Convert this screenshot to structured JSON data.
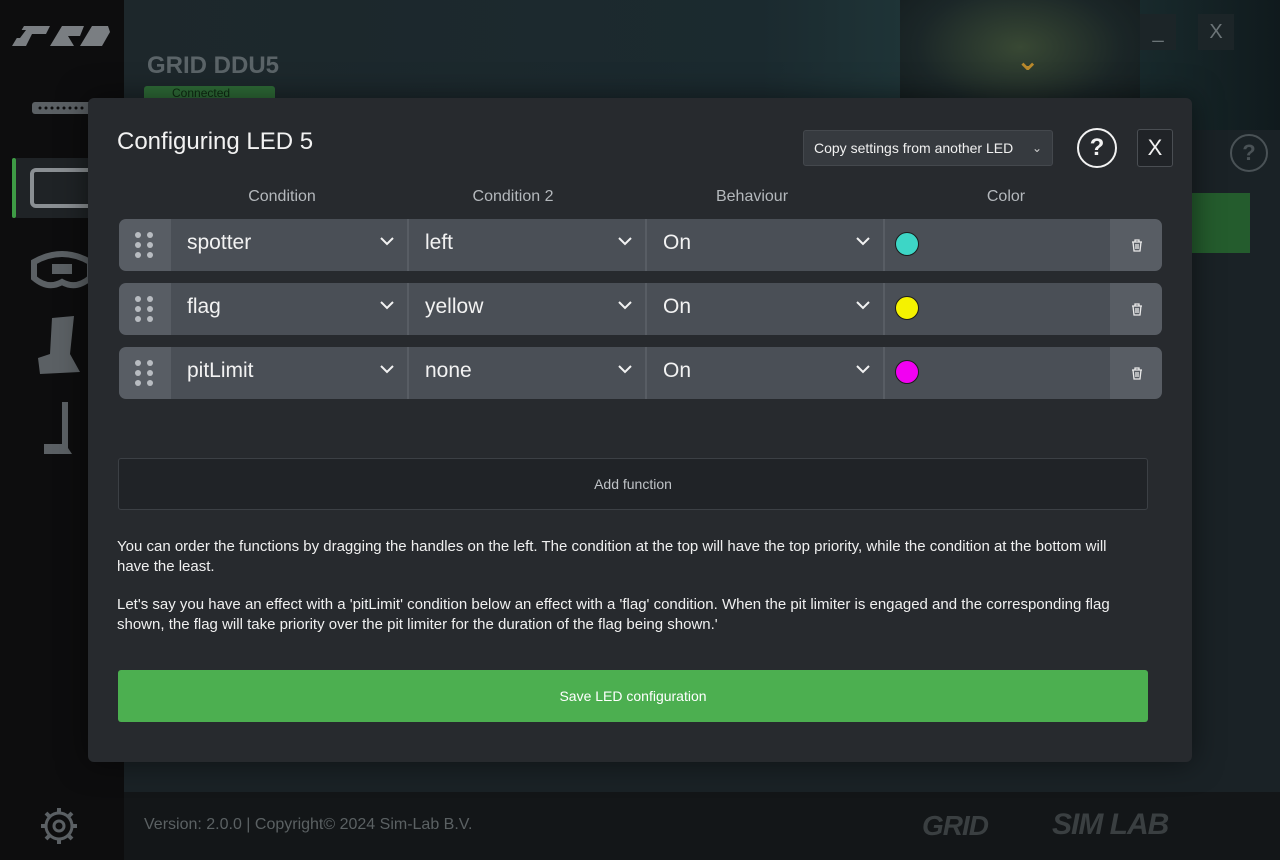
{
  "app": {
    "device_title": "GRID DDU5",
    "status_badge": "Connected",
    "minimize_label": "_",
    "close_label": "X",
    "help_label": "?",
    "version_text": "Version: 2.0.0 | Copyright© 2024 Sim-Lab B.V.",
    "brand_grid": "GRID",
    "brand_simlab": "SIM LAB"
  },
  "modal": {
    "title": "Configuring LED 5",
    "copy_select_label": "Copy settings from another LED",
    "help_label": "?",
    "close_label": "X",
    "columns": {
      "condition": "Condition",
      "condition2": "Condition 2",
      "behaviour": "Behaviour",
      "color": "Color"
    },
    "rows": [
      {
        "condition": "spotter",
        "condition2": "left",
        "behaviour": "On",
        "color": "#3dd6c6"
      },
      {
        "condition": "flag",
        "condition2": "yellow",
        "behaviour": "On",
        "color": "#f5f200"
      },
      {
        "condition": "pitLimit",
        "condition2": "none",
        "behaviour": "On",
        "color": "#f200f2"
      }
    ],
    "add_function_label": "Add function",
    "help_paragraph_1": "You can order the functions by dragging the handles on the left. The condition at the top will have the top priority, while the condition at the bottom will have the least.",
    "help_paragraph_2": "Let's say you have an effect with a 'pitLimit' condition below an effect with a 'flag' condition. When the pit limiter is engaged and the corresponding flag shown, the flag will take priority over the pit limiter for the duration of the flag being shown.'",
    "save_label": "Save LED configuration"
  }
}
